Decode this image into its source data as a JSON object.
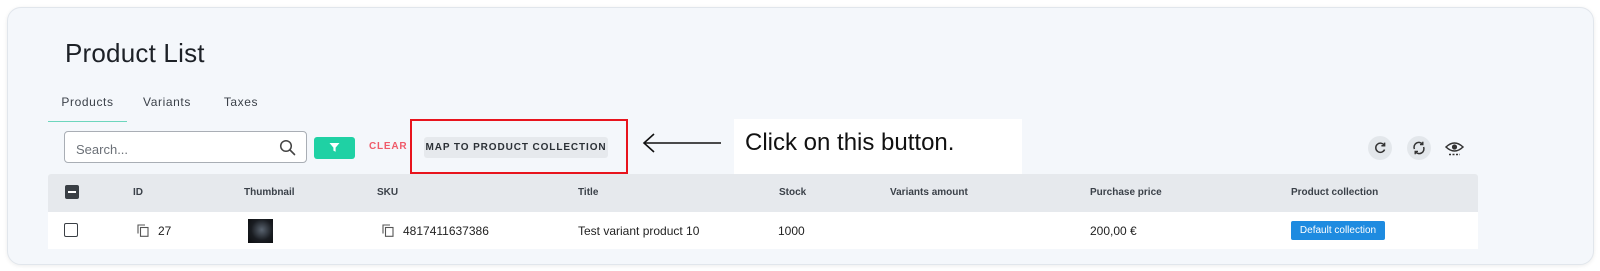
{
  "page": {
    "title": "Product List"
  },
  "tabs": [
    {
      "label": "Products",
      "active": true
    },
    {
      "label": "Variants",
      "active": false
    },
    {
      "label": "Taxes",
      "active": false
    }
  ],
  "search": {
    "placeholder": "Search...",
    "value": ""
  },
  "toolbar": {
    "clear_label": "CLEAR",
    "map_label": "MAP TO PRODUCT COLLECTION"
  },
  "callout": {
    "text": "Click on this button."
  },
  "table": {
    "columns": [
      "ID",
      "Thumbnail",
      "SKU",
      "Title",
      "Stock",
      "Variants amount",
      "Purchase price",
      "Product collection"
    ],
    "rows": [
      {
        "id": "27",
        "sku": "4817411637386",
        "title": "Test variant product 10",
        "stock": "1000",
        "variants_amount": "",
        "purchase_price": "200,00 €",
        "collection": "Default collection"
      }
    ]
  },
  "colors": {
    "accent": "#1fd1a4",
    "clear": "#ef5b6a",
    "highlight": "#e8141d",
    "badge": "#1e8be0"
  }
}
